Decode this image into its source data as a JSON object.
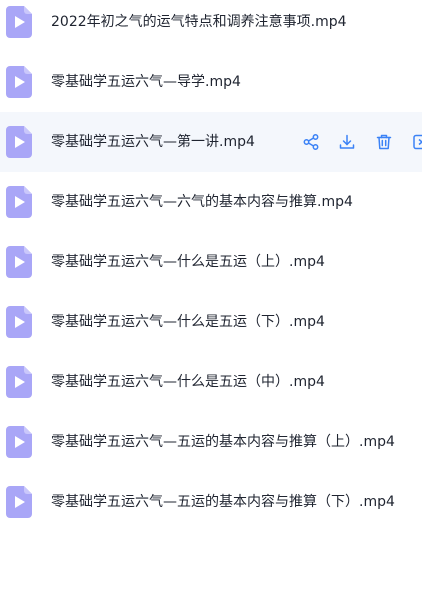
{
  "files": [
    {
      "name": "2022年初之气的运气特点和调养注意事项.mp4"
    },
    {
      "name": "零基础学五运六气—导学.mp4"
    },
    {
      "name": "零基础学五运六气—第一讲.mp4"
    },
    {
      "name": "零基础学五运六气—六气的基本内容与推算.mp4"
    },
    {
      "name": "零基础学五运六气—什么是五运（上）.mp4"
    },
    {
      "name": "零基础学五运六气—什么是五运（下）.mp4"
    },
    {
      "name": "零基础学五运六气—什么是五运（中）.mp4"
    },
    {
      "name": "零基础学五运六气—五运的基本内容与推算（上）.mp4"
    },
    {
      "name": "零基础学五运六气—五运的基本内容与推算（下）.mp4"
    }
  ],
  "hovered_row": 2,
  "row_actions": [
    "share-icon",
    "download-icon",
    "delete-icon",
    "more-icon"
  ],
  "colors": {
    "icon_fill": "#a9a6f7",
    "icon_fold": "#c9c7fb",
    "icon_play": "#ffffff",
    "action": "#3b82f6",
    "hover_bg": "#f4f7fc",
    "text": "#1f2430"
  }
}
